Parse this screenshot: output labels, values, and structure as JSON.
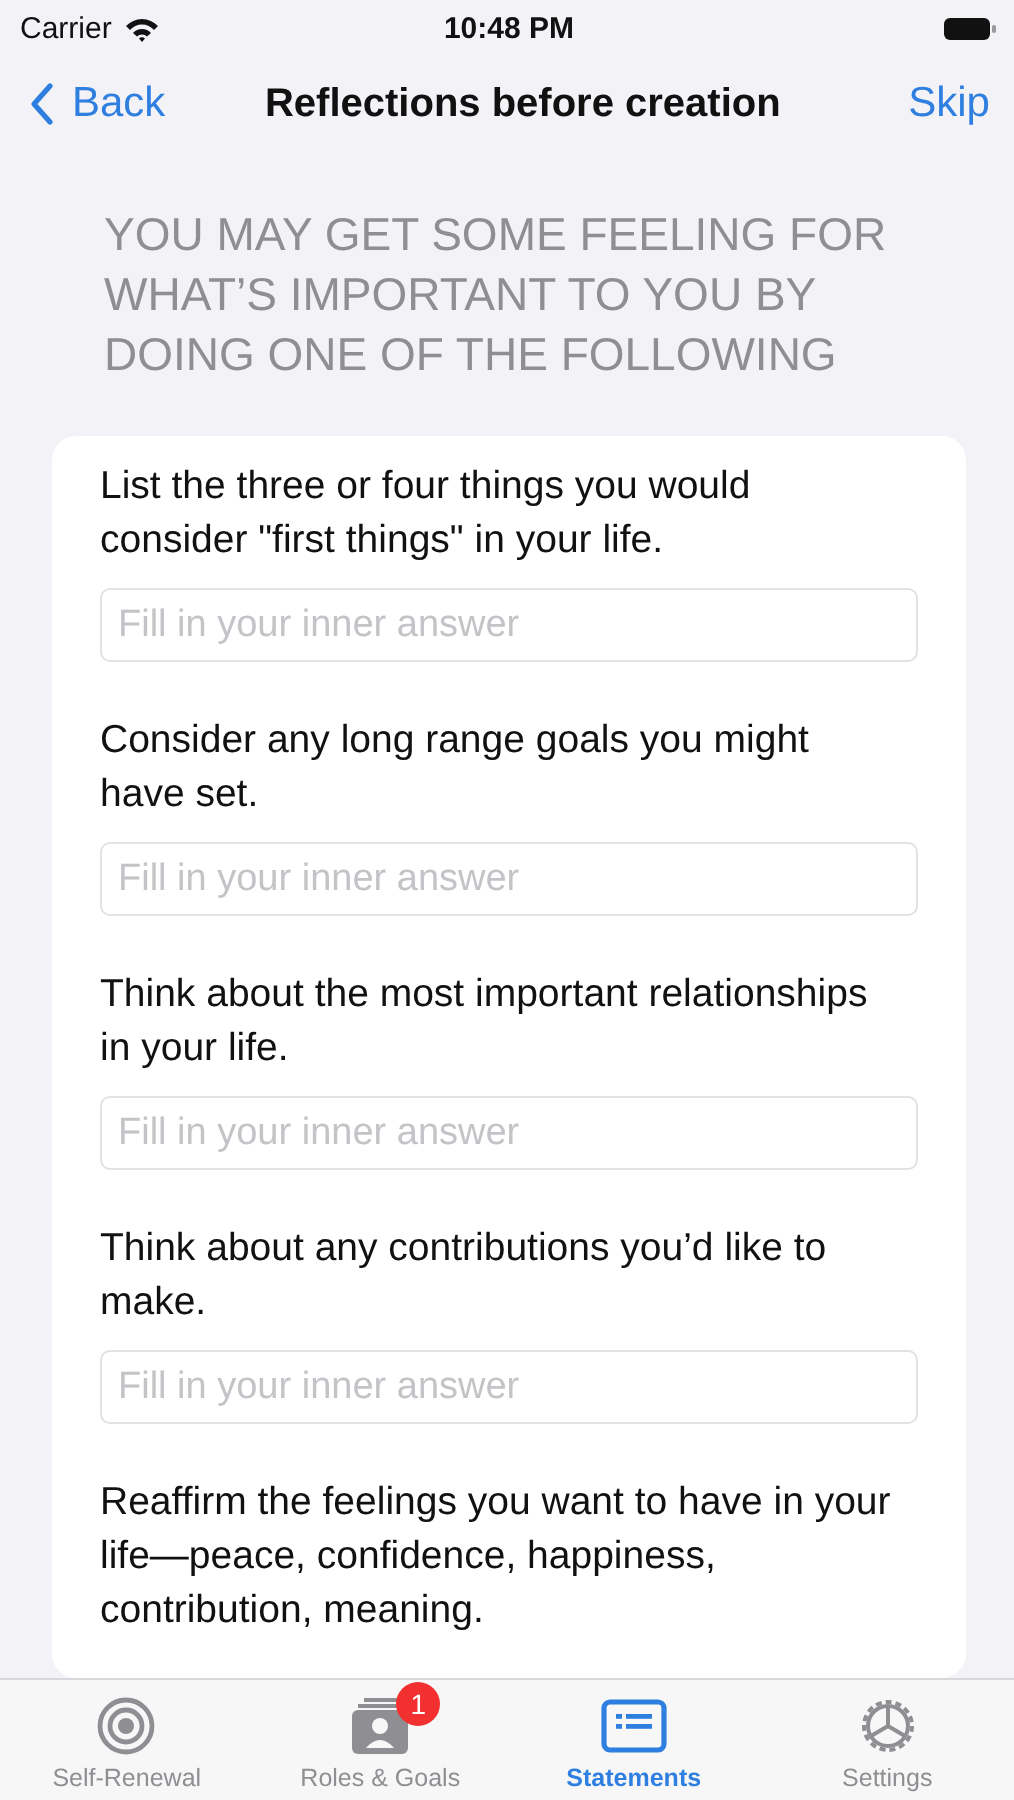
{
  "status_bar": {
    "carrier": "Carrier",
    "time": "10:48 PM"
  },
  "nav": {
    "back": "Back",
    "title": "Reflections before creation",
    "action": "Skip"
  },
  "intro": "YOU MAY GET SOME FEELING FOR WHAT’S IMPORTANT TO YOU BY DOING ONE OF THE FOLLOWING",
  "questions": [
    {
      "prompt": "List the three or four things you would consider \"first things\" in your life.",
      "placeholder": "Fill in your inner answer"
    },
    {
      "prompt": "Consider any long range goals you might have set.",
      "placeholder": "Fill in your inner answer"
    },
    {
      "prompt": "Think about the most important relationships in your life.",
      "placeholder": "Fill in your inner answer"
    },
    {
      "prompt": "Think about any contributions you’d like to make.",
      "placeholder": "Fill in your inner answer"
    },
    {
      "prompt": "Reaffirm the feelings you want to have in your life—peace, confidence, happiness, contribution, meaning."
    }
  ],
  "tabs": [
    {
      "kind": "target",
      "label": "Self-Renewal",
      "selected": false
    },
    {
      "kind": "contacts",
      "label": "Roles & Goals",
      "selected": false,
      "badge": "1"
    },
    {
      "kind": "list",
      "label": "Statements",
      "selected": true
    },
    {
      "kind": "gear",
      "label": "Settings",
      "selected": false
    }
  ]
}
